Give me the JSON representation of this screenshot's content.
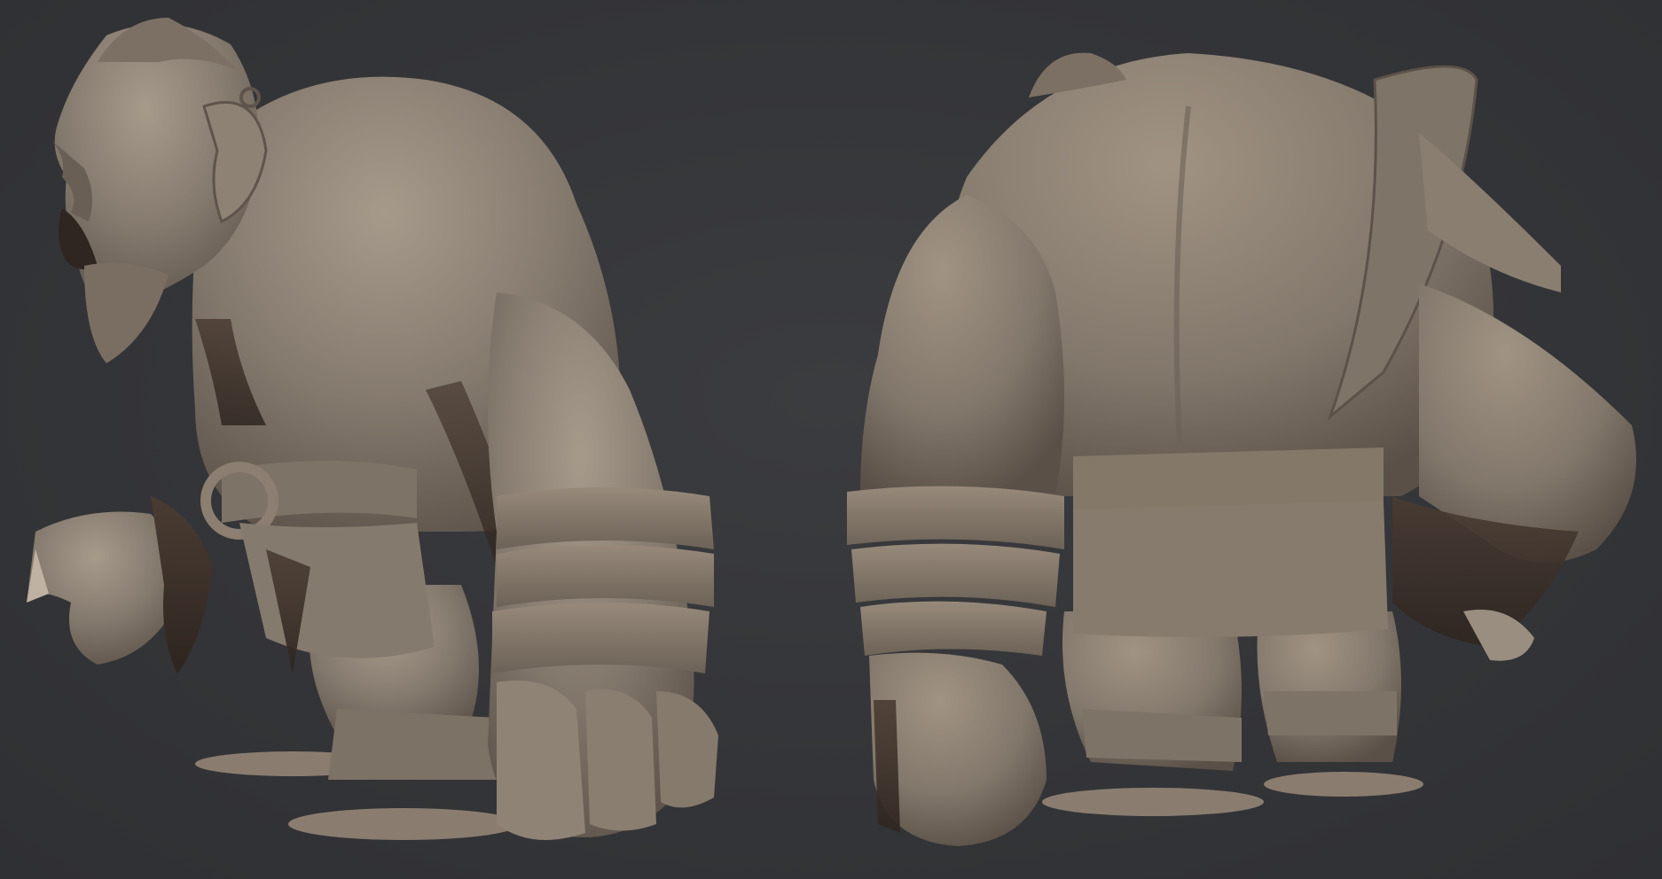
{
  "scene": {
    "background_color": "#36373a",
    "clay_color": "#8a7e72",
    "clay_highlight": "#a39686",
    "clay_shadow": "#3a2f28",
    "views": [
      {
        "label": ""
      },
      {
        "label": ""
      }
    ]
  }
}
